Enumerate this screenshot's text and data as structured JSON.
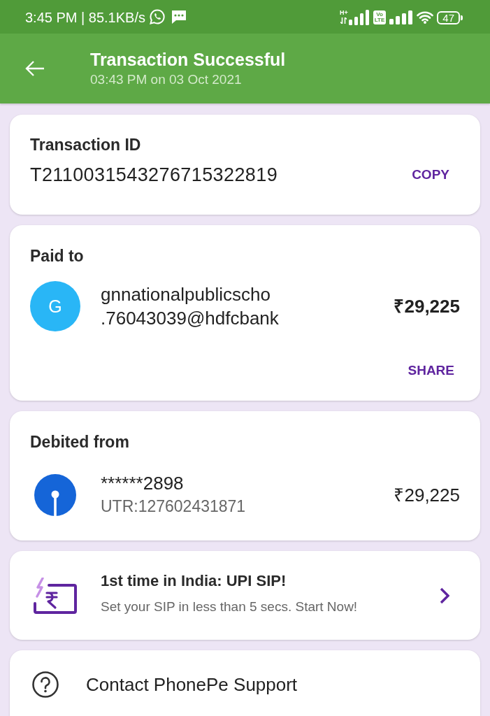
{
  "status_bar": {
    "time": "3:45 PM | 85.1KB/s",
    "network_type": "H+",
    "volte_badge": [
      "Vo",
      "LTE"
    ],
    "battery": "47"
  },
  "app_bar": {
    "title": "Transaction Successful",
    "subtitle": "03:43 PM on 03 Oct 2021"
  },
  "transaction_card": {
    "label": "Transaction ID",
    "transaction_id": "T2110031543276715322819",
    "copy_button": "COPY"
  },
  "paid_to_card": {
    "label": "Paid to",
    "avatar_letter": "G",
    "payee_lines": [
      "gnnationalpublicscho",
      ".76043039@hdfcbank"
    ],
    "amount": "₹29,225",
    "share_button": "SHARE"
  },
  "debited_from_card": {
    "label": "Debited from",
    "account": "******2898",
    "utr": "UTR:127602431871",
    "amount": "₹29,225"
  },
  "promo_card": {
    "title": "1st time in India: UPI SIP!",
    "subtitle": "Set your SIP in less than 5 secs. Start Now!"
  },
  "support_card": {
    "label": "Contact PhonePe Support"
  }
}
